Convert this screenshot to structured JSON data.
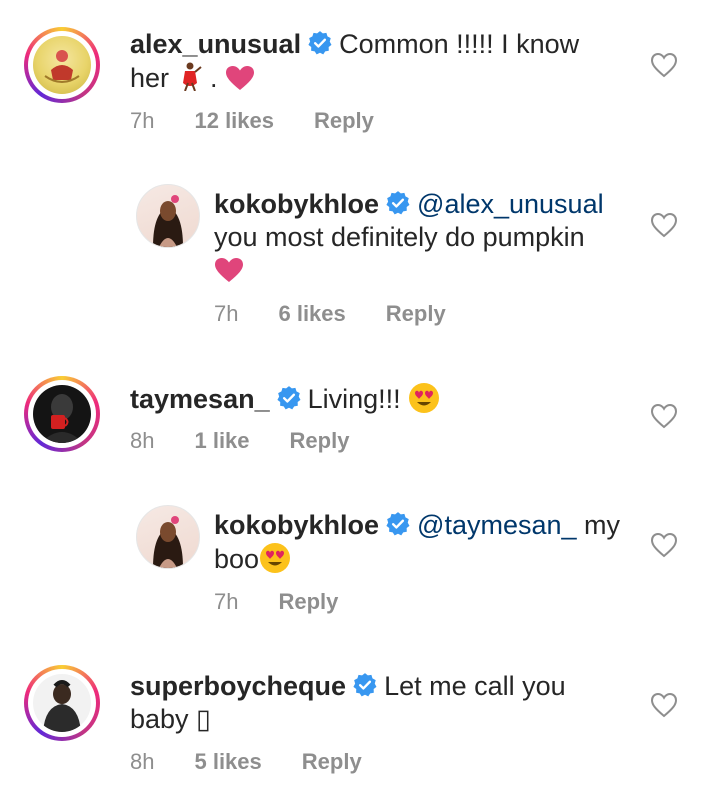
{
  "comments": [
    {
      "username": "alex_unusual",
      "verified": true,
      "text_line1": "Common !!!!! I know",
      "text_line2_prefix": "her",
      "text_line2_mid": " .",
      "time": "7h",
      "likes": "12 likes",
      "reply": "Reply"
    },
    {
      "username": "kokobykhloe",
      "verified": true,
      "mention": "@alex_unusual",
      "text_line2": "you most definitely do pumpkin",
      "time": "7h",
      "likes": "6 likes",
      "reply": "Reply"
    },
    {
      "username": "taymesan_",
      "verified": true,
      "text": "Living!!!",
      "time": "8h",
      "likes": "1 like",
      "reply": "Reply"
    },
    {
      "username": "kokobykhloe",
      "verified": true,
      "mention": "@taymesan_",
      "text_after_mention": " my",
      "text_line2": "boo",
      "time": "7h",
      "reply": "Reply"
    },
    {
      "username": "superboycheque",
      "verified": true,
      "text_line1": "Let me call you",
      "text_line2": "baby ▯",
      "time": "8h",
      "likes": "5 likes",
      "reply": "Reply"
    }
  ],
  "colors": {
    "text": "#262626",
    "meta": "#8e8e8e",
    "verified_blue": "#3897f0",
    "mention": "#00376b",
    "heart_pink": "#e0457b"
  },
  "icons": [
    "verified-badge-icon",
    "like-heart-outline-icon",
    "pink-heart-emoji",
    "heart-eyes-emoji",
    "dancer-emoji"
  ]
}
